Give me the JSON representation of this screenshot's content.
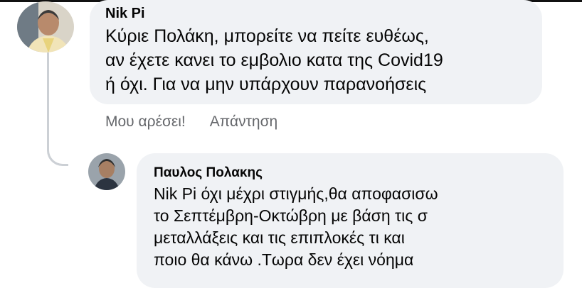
{
  "comment": {
    "author": "Nik Pi",
    "text": "Κύριε Πολάκη, μπορείτε να πείτε ευθέως,\nαν έχετε κανει το εμβολιο κατα της Covid19\nή όχι. Για να μην υπάρχουν παρανοήσεις",
    "actions": {
      "like_label": "Μου αρέσει!",
      "reply_label": "Απάντηση"
    }
  },
  "reply": {
    "author": "Παυλος Πολακης",
    "text": "Nik Pi όχι μέχρι στιγμής,θα αποφασισω\nτο Σεπτέμβρη-Οκτώβρη με βάση τις σ\nμεταλλάξεις και τις επιπλοκές τι και\nποιο θα κάνω .Τωρα δεν έχει νόημα"
  },
  "colors": {
    "bubble": "#f0f2f5",
    "action_text": "#65676b",
    "thread_line": "#ccd0d5"
  },
  "icons": {
    "comment_avatar": "user-photo-avatar",
    "reply_avatar": "user-photo-avatar"
  }
}
